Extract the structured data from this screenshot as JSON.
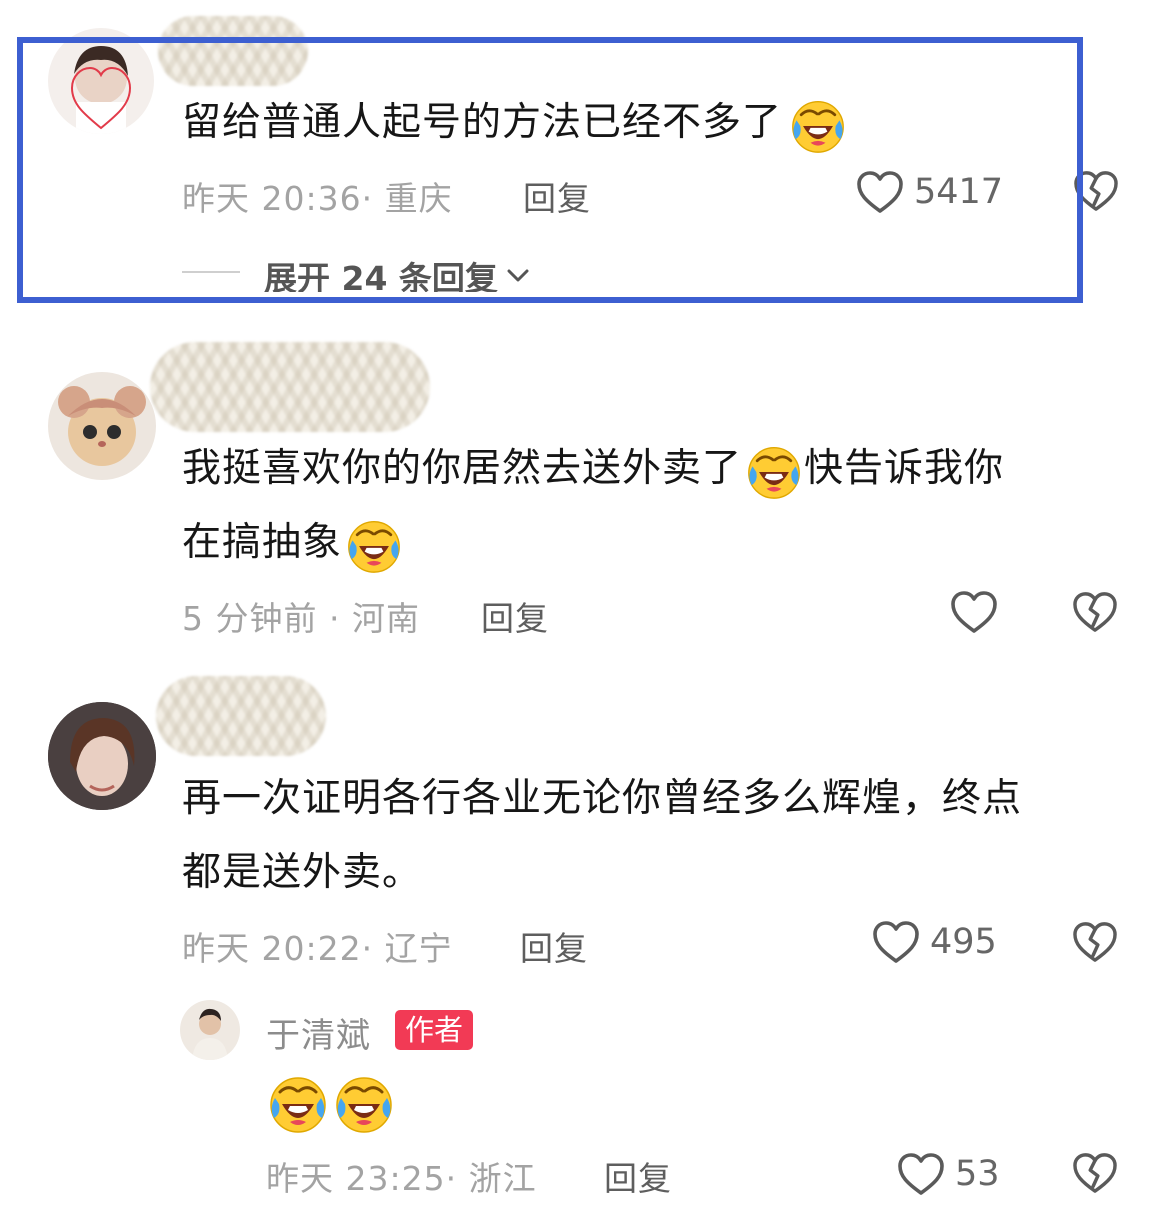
{
  "comments": [
    {
      "text": "留给普通人起号的方法已经不多了",
      "time_location": "昨天 20:36· 重庆",
      "reply_label": "回复",
      "likes": "5417",
      "expand_label": "展开 24 条回复"
    },
    {
      "text_line1": "我挺喜欢你的你居然去送外卖了",
      "text_line1_tail": "快告诉我你",
      "text_line2": "在搞抽象",
      "time_location": "5 分钟前 · 河南",
      "reply_label": "回复"
    },
    {
      "text_line1": "再一次证明各行各业无论你曾经多么辉煌，终点",
      "text_line2": "都是送外卖。",
      "time_location": "昨天 20:22· 辽宁",
      "reply_label": "回复",
      "likes": "495",
      "reply": {
        "username": "于清斌",
        "badge": "作者",
        "time_location": "昨天 23:25· 浙江",
        "reply_label": "回复",
        "likes": "53"
      }
    }
  ],
  "icons": {
    "like": "heart-outline-icon",
    "dislike": "broken-heart-icon",
    "expand": "chevron-down-icon",
    "emoji": "crying-laughing-emoji"
  },
  "colors": {
    "highlight_border": "#3d5fd1",
    "author_badge": "#f23a55",
    "meta_text": "#a3a3a3"
  }
}
